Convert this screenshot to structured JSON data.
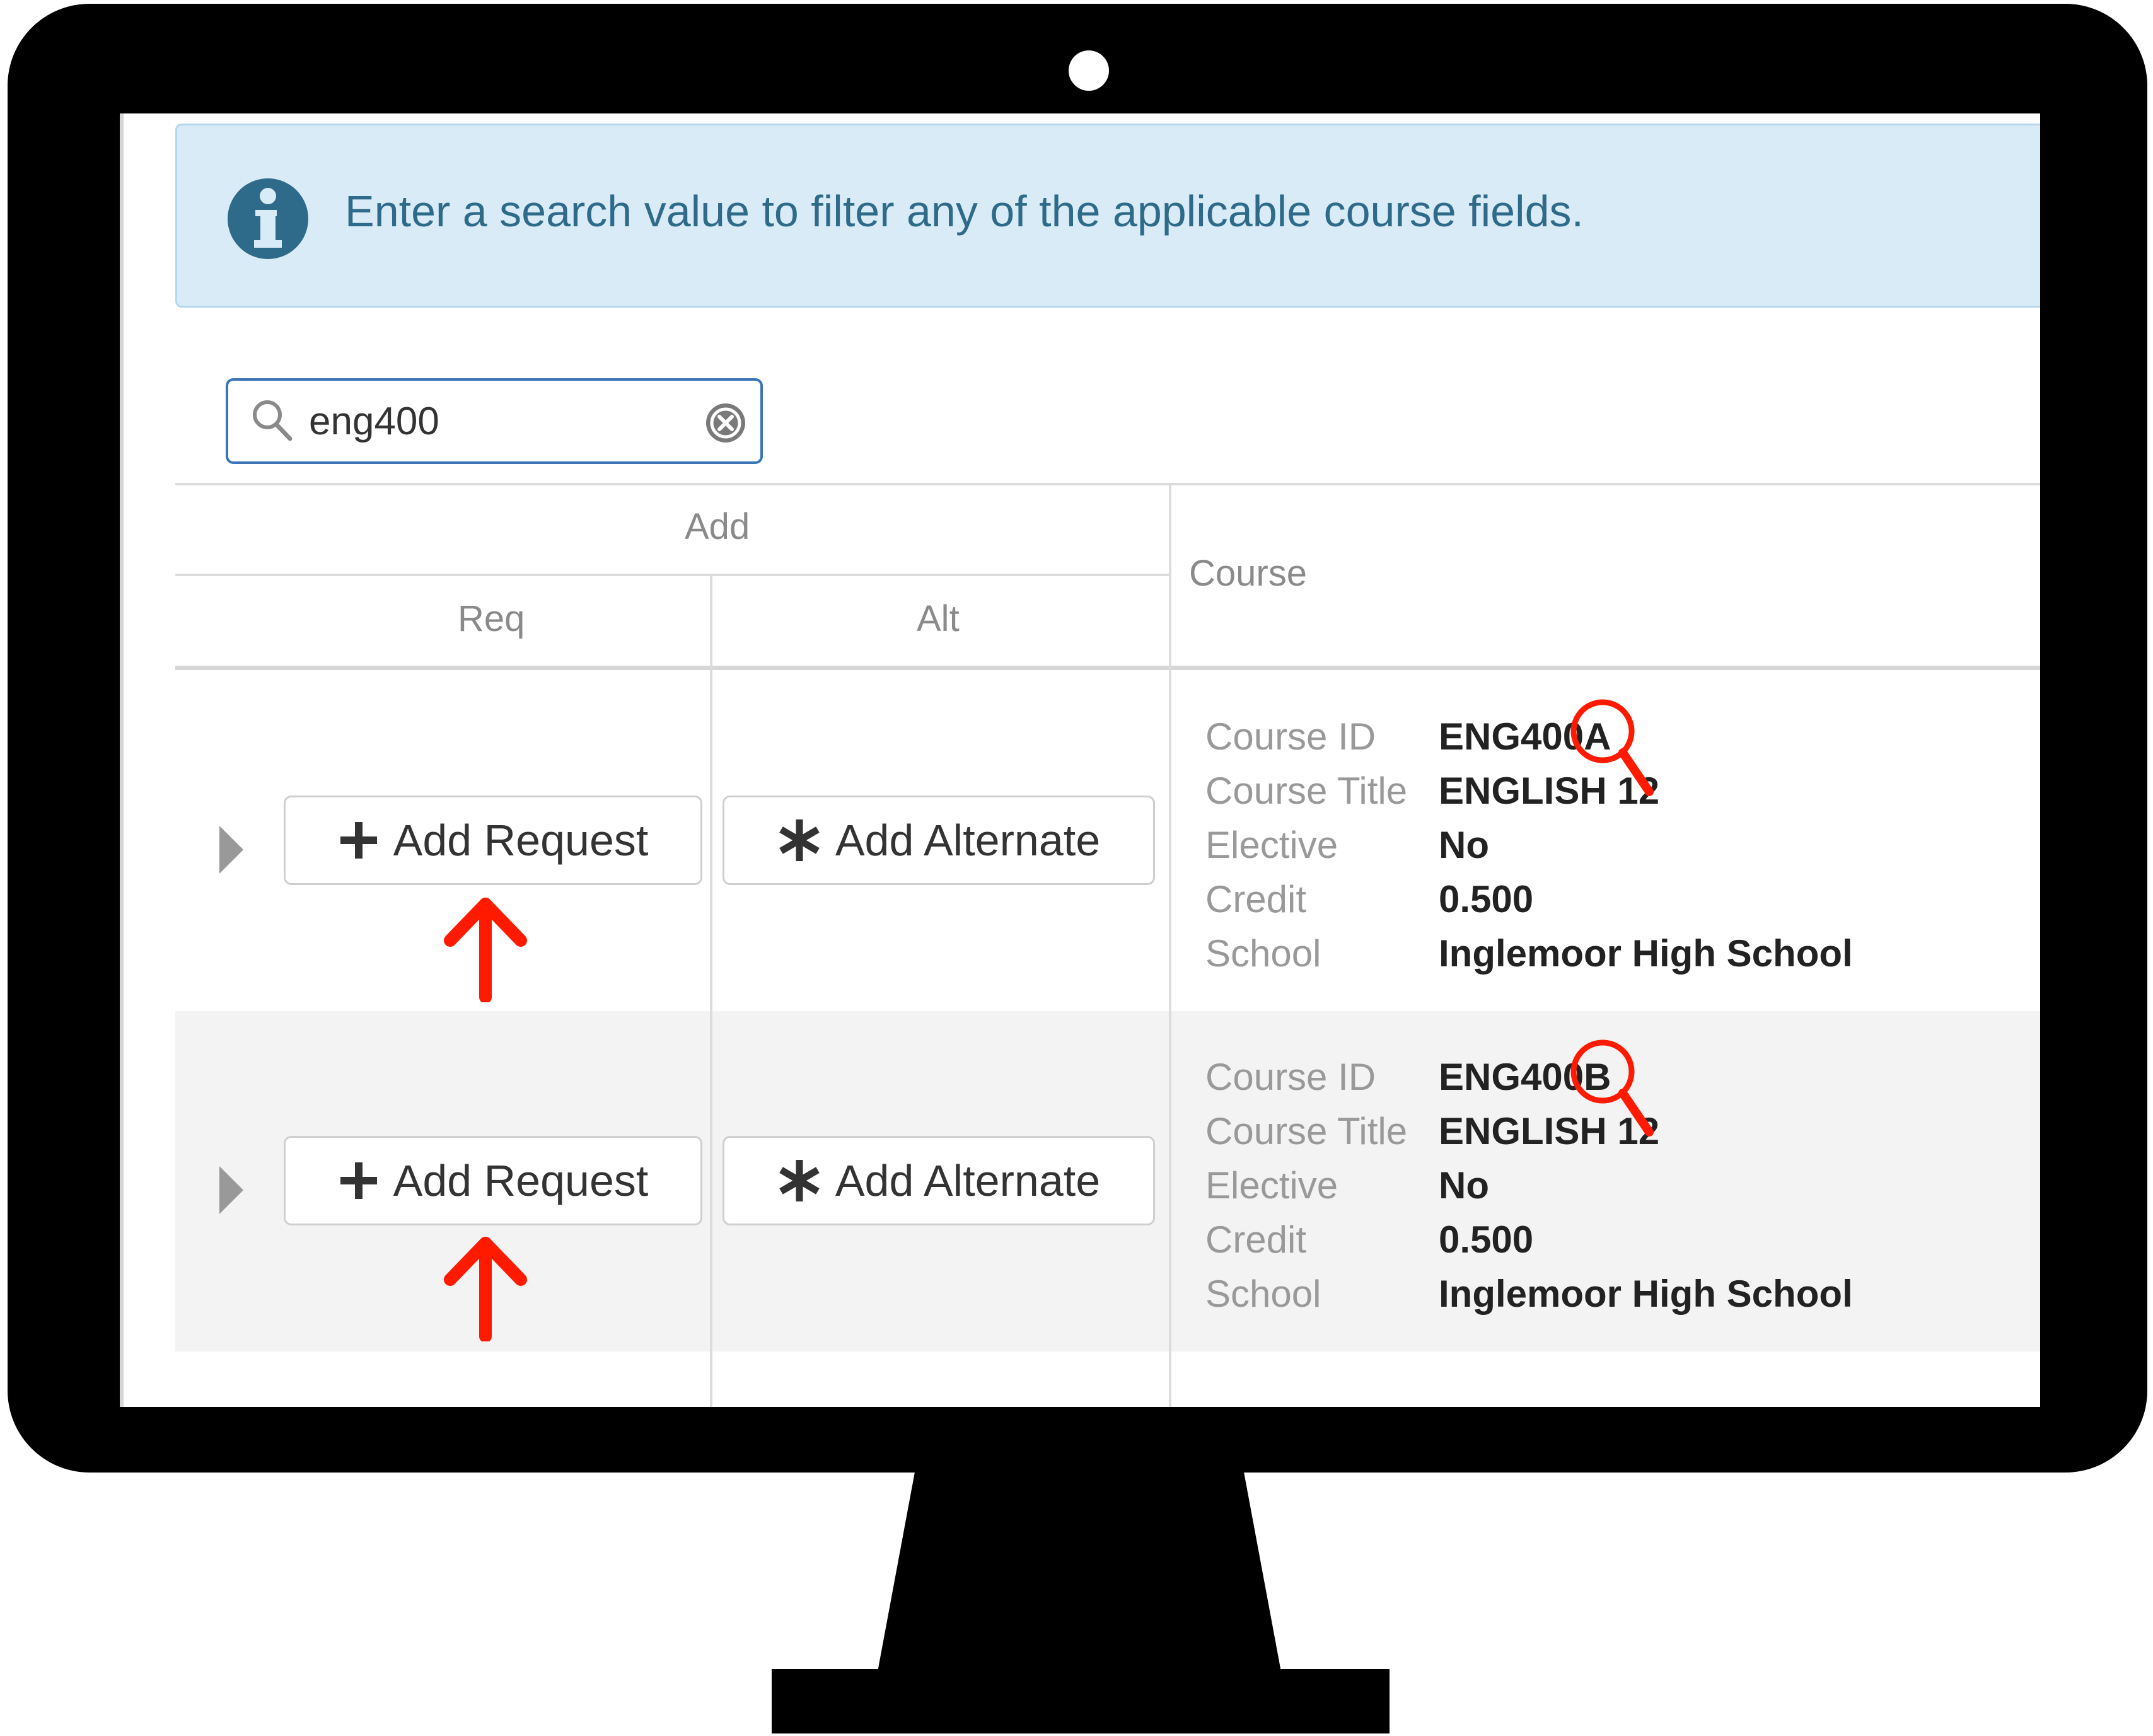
{
  "info_banner": {
    "text": "Enter a search value to filter any of the applicable course fields.",
    "icon": "info-icon",
    "color": "#2e6a8a"
  },
  "search": {
    "value": "eng400",
    "icon": "search-icon",
    "clear_icon": "clear-icon"
  },
  "table": {
    "header_add": "Add",
    "header_req": "Req",
    "header_alt": "Alt",
    "header_course": "Course",
    "rows": [
      {
        "add_request_label": "Add Request",
        "add_alternate_label": "Add Alternate",
        "fields": [
          {
            "label": "Course ID",
            "value": "ENG400A"
          },
          {
            "label": "Course Title",
            "value": "ENGLISH 12"
          },
          {
            "label": "Elective",
            "value": "No"
          },
          {
            "label": "Credit",
            "value": "0.500"
          },
          {
            "label": "School",
            "value": "Inglemoor High School"
          }
        ]
      },
      {
        "add_request_label": "Add Request",
        "add_alternate_label": "Add Alternate",
        "fields": [
          {
            "label": "Course ID",
            "value": "ENG400B"
          },
          {
            "label": "Course Title",
            "value": "ENGLISH 12"
          },
          {
            "label": "Elective",
            "value": "No"
          },
          {
            "label": "Credit",
            "value": "0.500"
          },
          {
            "label": "School",
            "value": "Inglemoor High School"
          }
        ]
      }
    ]
  },
  "annotations": {
    "arrow_color": "#ff1a00",
    "arrow_icon": "up-arrow-icon",
    "magnifier_icon": "magnifier-icon"
  }
}
